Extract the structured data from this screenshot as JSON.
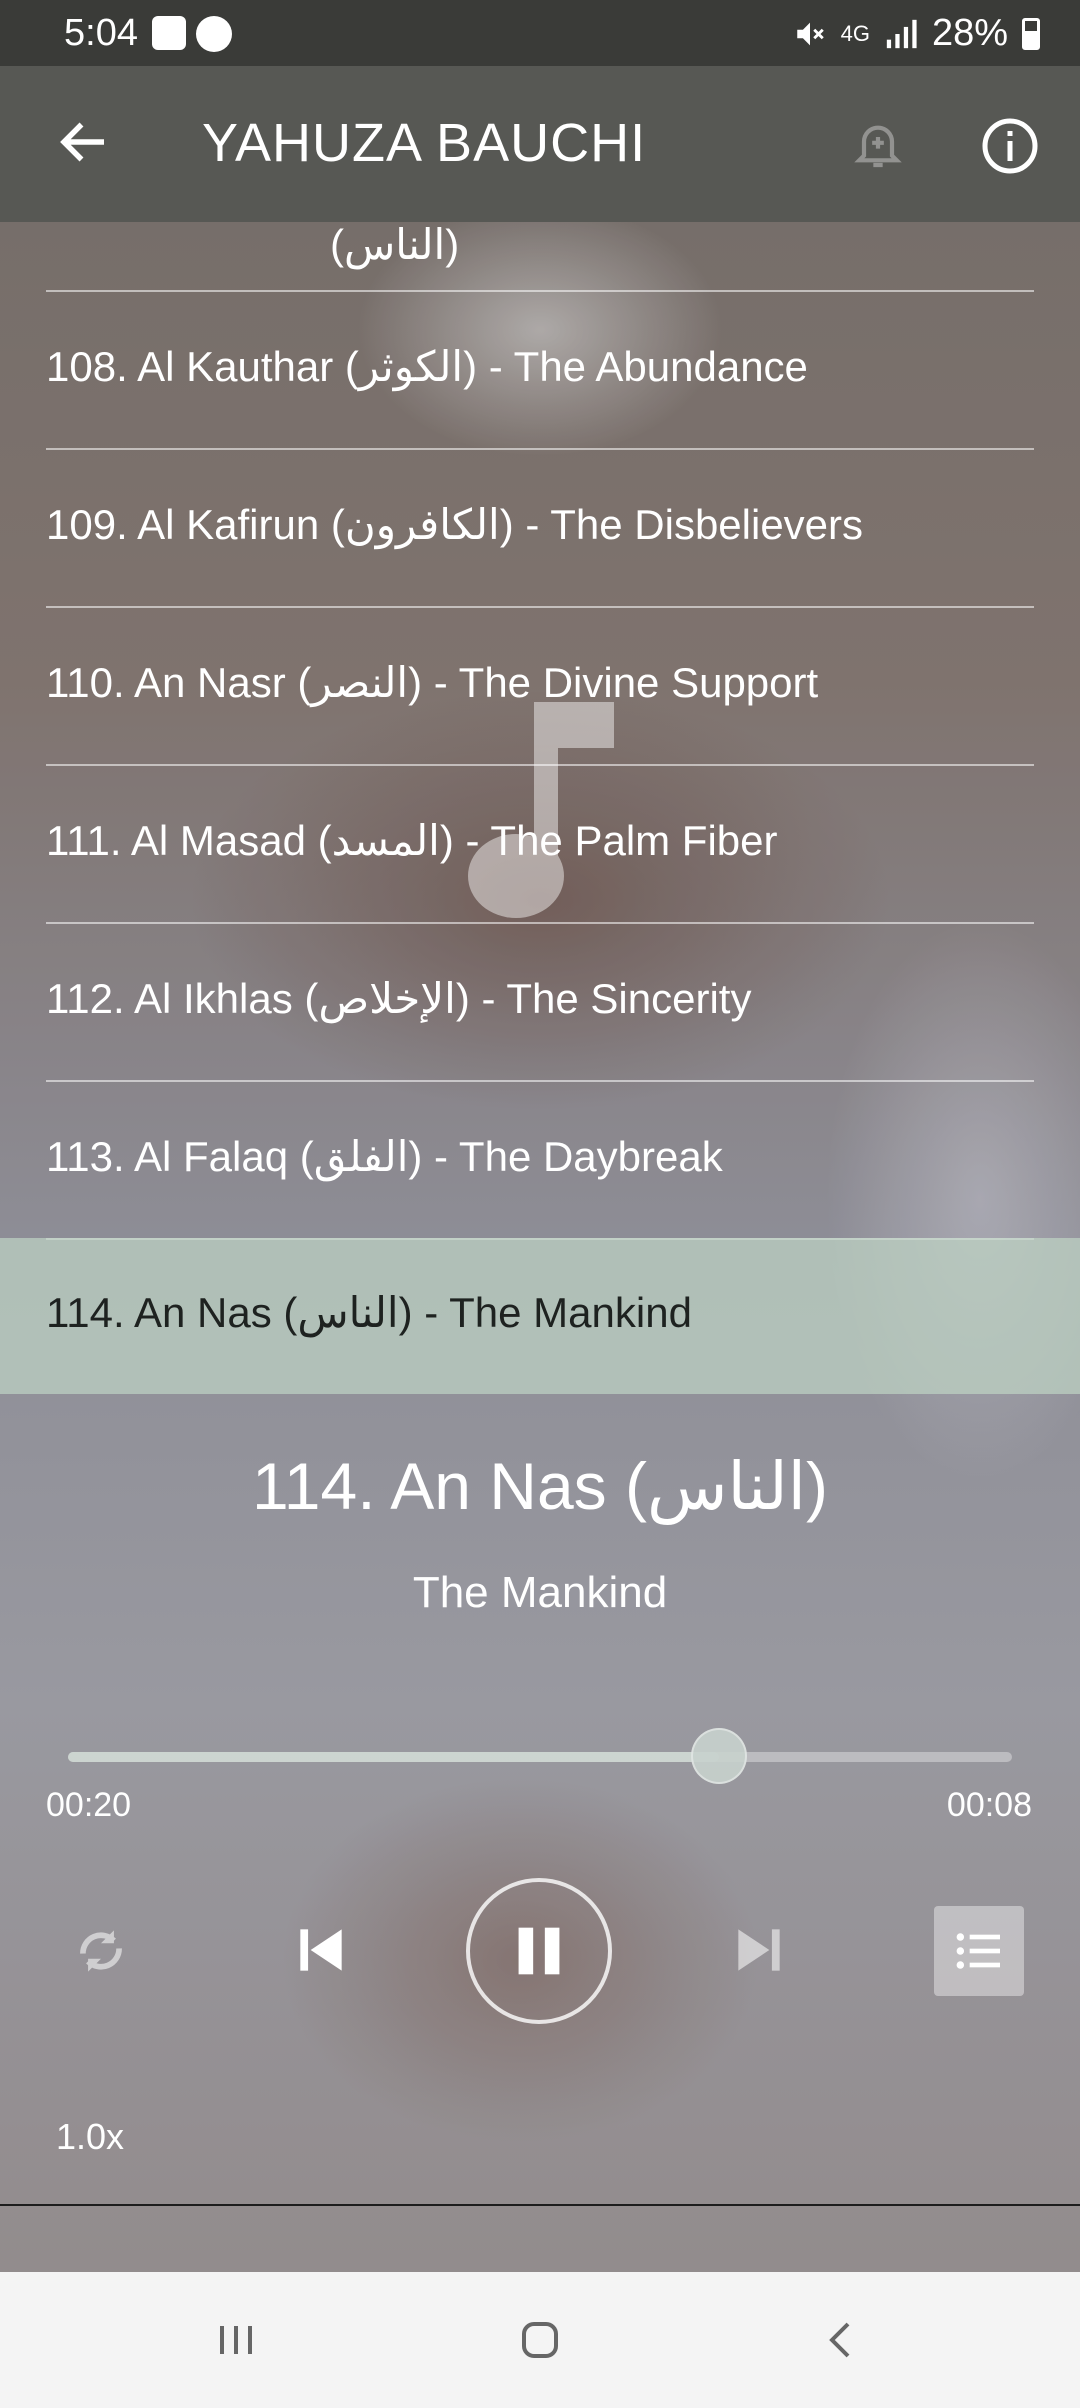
{
  "status_bar": {
    "time": "5:04",
    "network": "4G",
    "battery": "28%"
  },
  "app_bar": {
    "title": "YAHUZA BAUCHI",
    "icons": [
      "back-arrow-icon",
      "bell-add-icon",
      "info-icon"
    ]
  },
  "list": {
    "partial_top_label": "(الناس)",
    "items": [
      {
        "label": "108. Al Kauthar (الكوثر) - The Abundance"
      },
      {
        "label": "109. Al Kafirun (الكافرون) - The Disbelievers"
      },
      {
        "label": "110. An Nasr (النصر) - The Divine Support"
      },
      {
        "label": "111. Al Masad (المسد) - The Palm Fiber"
      },
      {
        "label": "112. Al Ikhlas (الإخلاص) - The Sincerity"
      },
      {
        "label": "113. Al Falaq (الفلق) - The Daybreak"
      },
      {
        "label": "114. An Nas (الناس) - The Mankind",
        "active": true
      }
    ]
  },
  "player": {
    "title": "114. An Nas (الناس)",
    "subtitle": "The Mankind",
    "elapsed": "00:20",
    "remaining": "00:08",
    "progress": 0.69,
    "speed": "1.0x",
    "colors": {
      "active_row": "#bed2c3",
      "seek_fill": "#cdd7d2"
    }
  }
}
